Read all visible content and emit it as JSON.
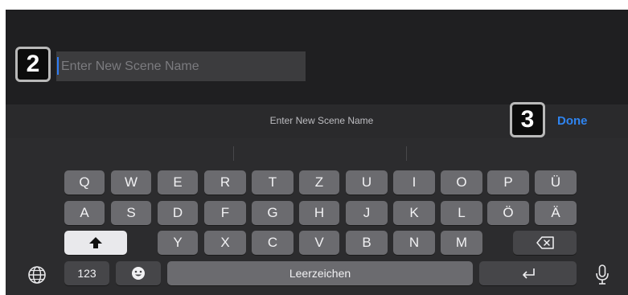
{
  "scene_name": {
    "placeholder": "Enter New Scene Name",
    "value": ""
  },
  "badges": {
    "input_badge": "2",
    "done_badge": "3"
  },
  "toolbar": {
    "title": "Enter New Scene Name",
    "done_label": "Done"
  },
  "keyboard": {
    "row1": [
      "Q",
      "W",
      "E",
      "R",
      "T",
      "Z",
      "U",
      "I",
      "O",
      "P",
      "Ü"
    ],
    "row2": [
      "A",
      "S",
      "D",
      "F",
      "G",
      "H",
      "J",
      "K",
      "L",
      "Ö",
      "Ä"
    ],
    "row3": [
      "Y",
      "X",
      "C",
      "V",
      "B",
      "N",
      "M"
    ],
    "numbers_label": "123",
    "space_label": "Leerzeichen",
    "icons": {
      "shift": "shift-icon",
      "backspace": "backspace-icon",
      "return": "return-icon",
      "emoji": "emoji-icon",
      "globe": "globe-icon",
      "mic": "microphone-icon"
    }
  },
  "colors": {
    "accent": "#2f84f0",
    "key": "#6b6b6f",
    "key_dark": "#464649",
    "keyboard_bg": "#2c2c2e"
  }
}
